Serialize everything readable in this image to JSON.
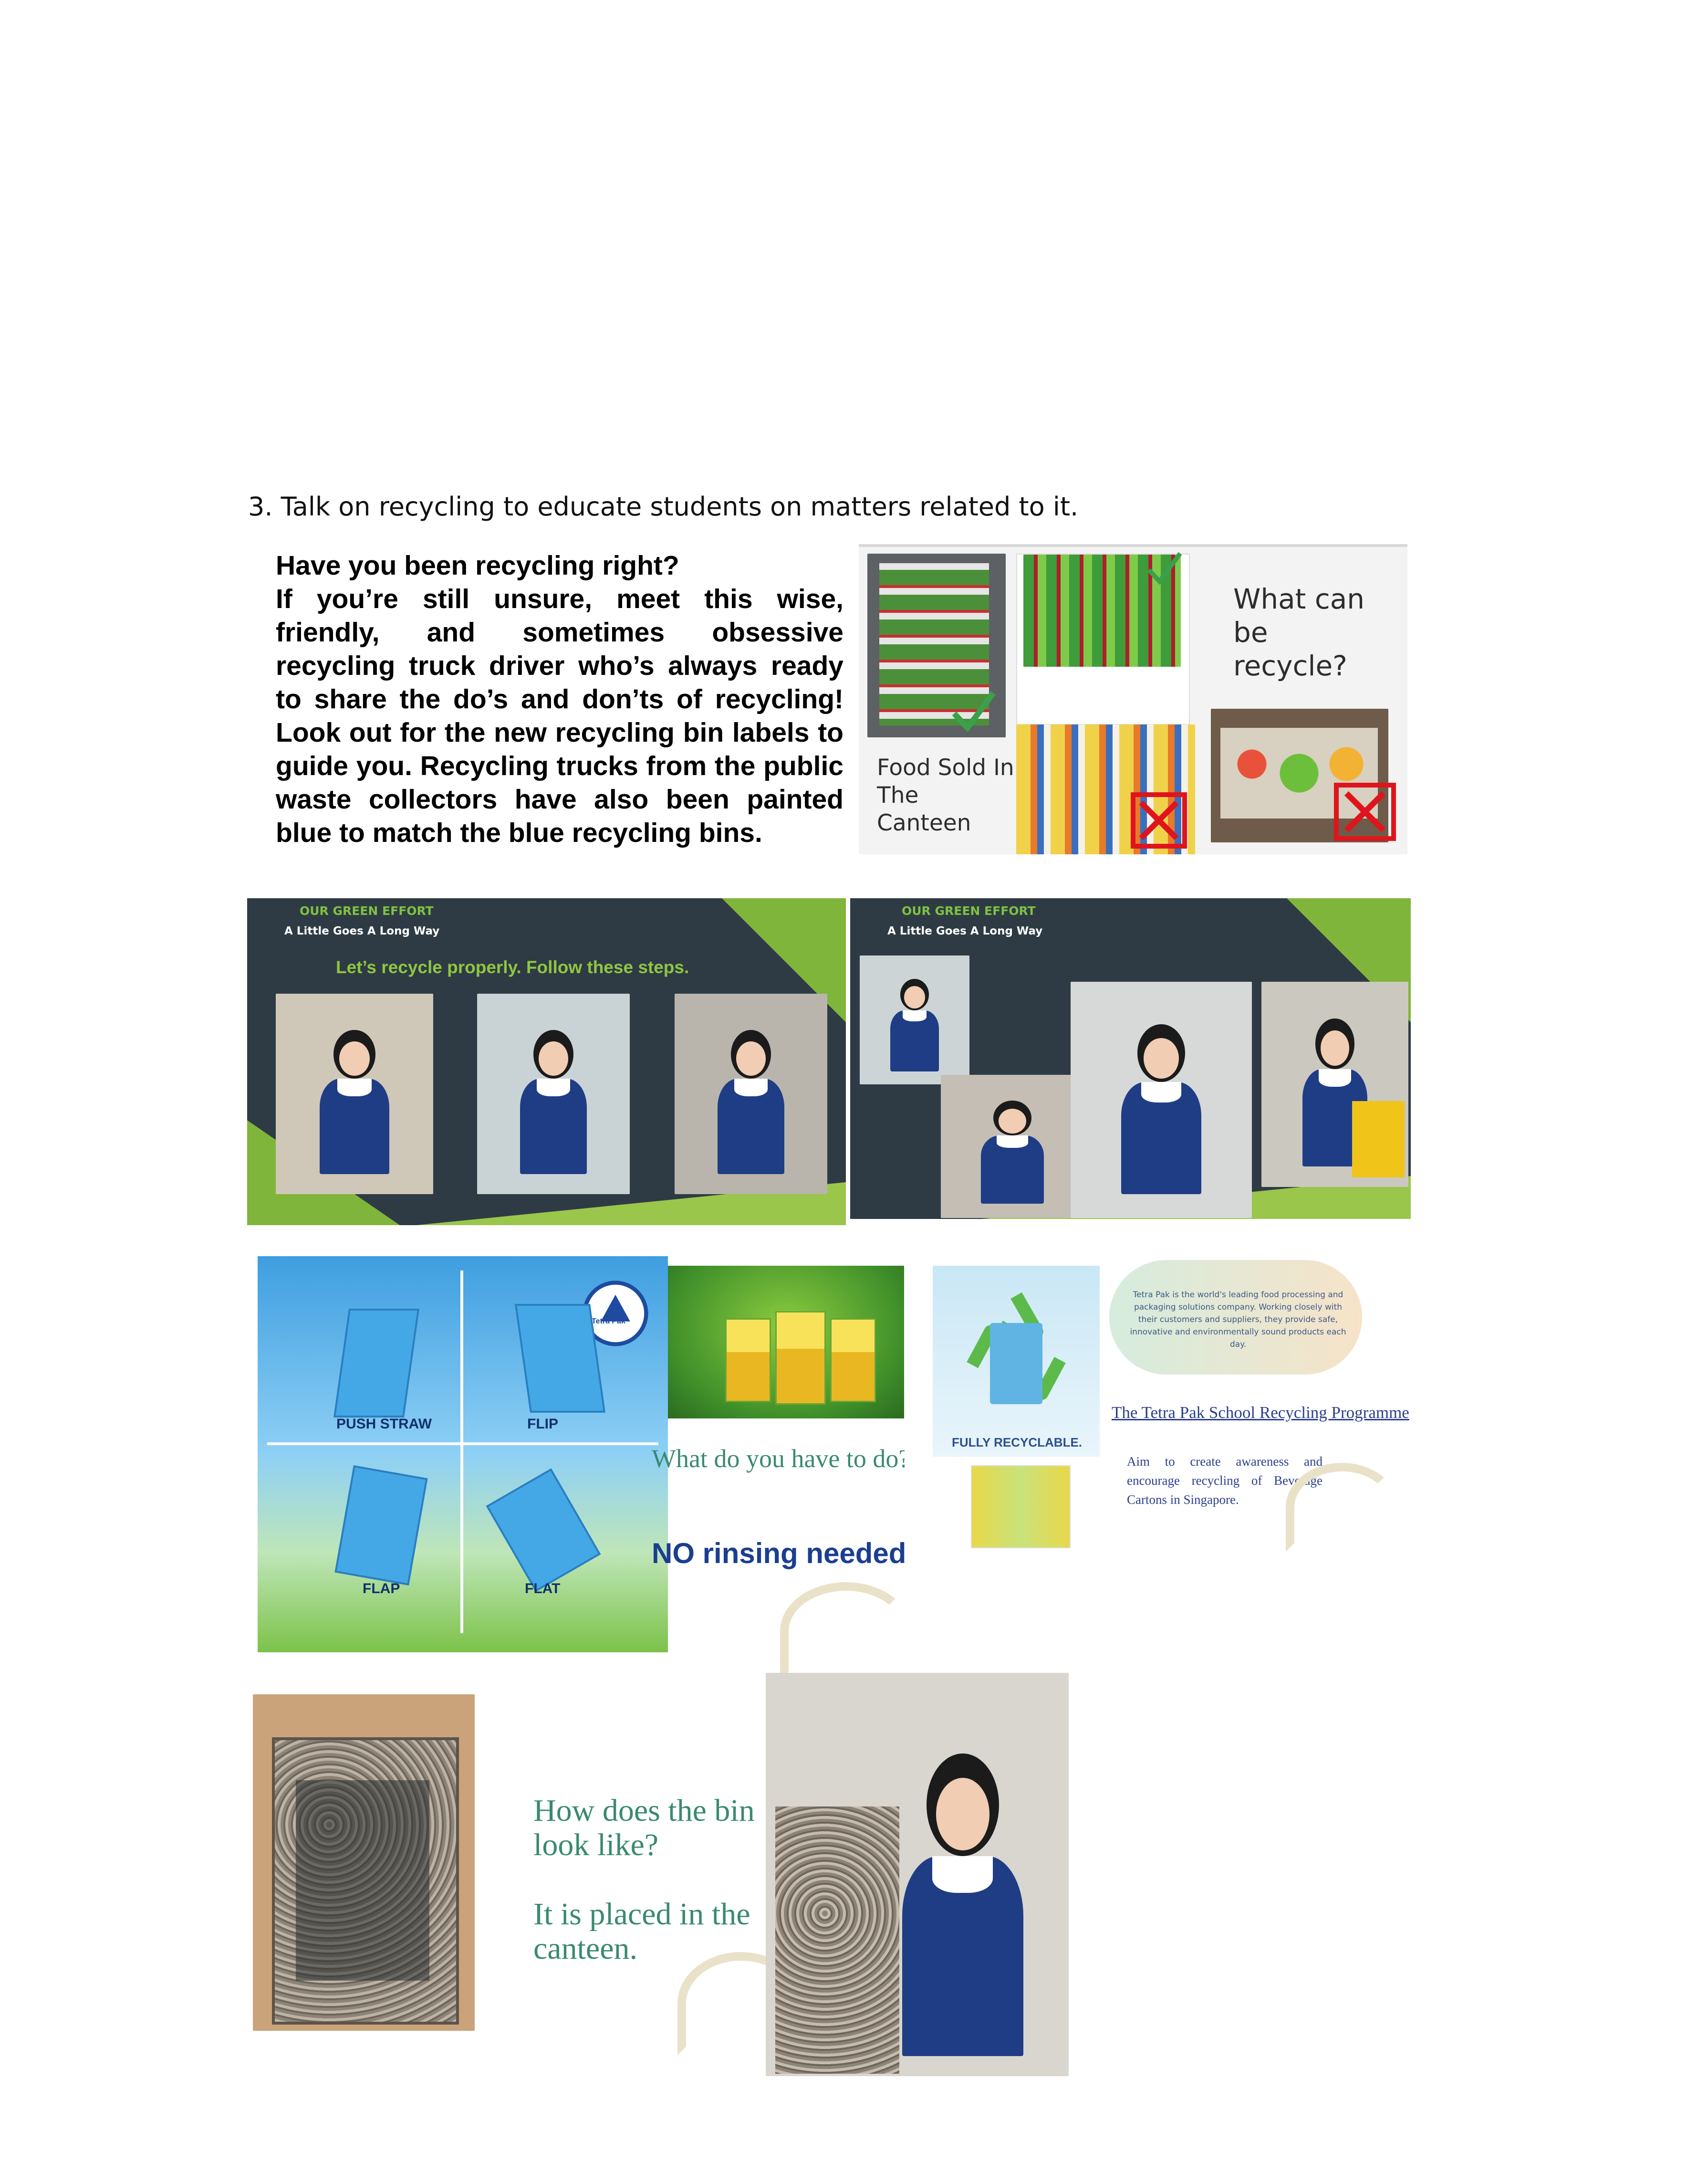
{
  "heading": "3.  Talk on recycling to educate students on matters related to it.",
  "intro": {
    "question": "Have you been recycling right?",
    "body": "If you’re still unsure, meet this wise, friendly, and sometimes obsessive recycling truck driver who’s always ready to share the do’s and don’ts of recycling!   Look out for the new recycling bin labels to guide you. Recycling trucks from the public waste collectors have also been painted blue to match the blue recycling bins."
  },
  "canteen_slide": {
    "question": "What can be recycle?",
    "caption": "Food Sold In The Canteen",
    "check_icon": "check-mark",
    "cross_icon": "red-cross-box"
  },
  "slide_left": {
    "kicker": "OUR GREEN EFFORT",
    "tagline": "A Little Goes  A Long Way",
    "instruction": "Let’s recycle properly. Follow these steps."
  },
  "slide_right": {
    "kicker": "OUR GREEN EFFORT",
    "tagline": "A Little Goes  A Long Way"
  },
  "steps": {
    "step1": "PUSH STRAW",
    "step2": "FLIP",
    "step3": "FLAP",
    "step4": "FLAT",
    "logo": "Tetra Pak",
    "question": "What do you have to do?",
    "note": "NO rinsing needed"
  },
  "tetrapak": {
    "about": "Tetra Pak is the world's leading food processing and packaging solutions company. Working closely with their customers and suppliers, they provide safe, innovative and environmentally sound products each day.",
    "programme": "The Tetra Pak School Recycling Programme",
    "aim": "Aim to create awareness and encourage recycling of Beverage Cartons in Singapore.",
    "badge": "FULLY RECYCLABLE."
  },
  "bin": {
    "question": "How does the bin look like?",
    "answer": "It is placed in the canteen."
  },
  "colors": {
    "slide_bg": "#2e3b44",
    "slide_green": "#7fb53a",
    "cross_red": "#e0141c",
    "check_green": "#3aa04a",
    "teal_text": "#3a8a6e"
  }
}
